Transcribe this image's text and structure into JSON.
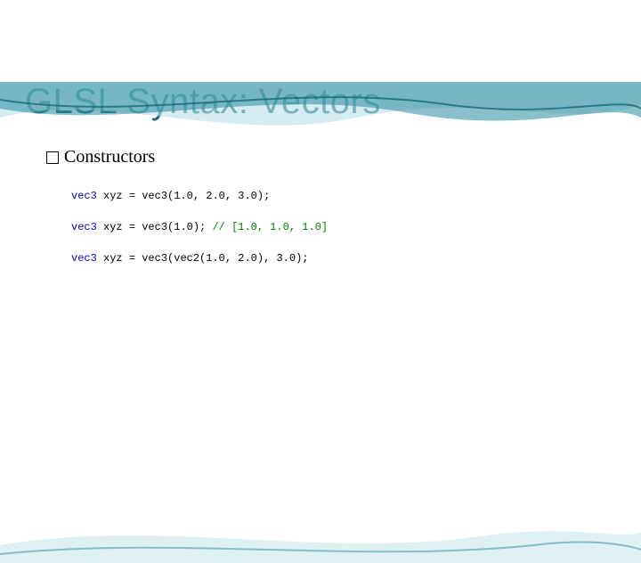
{
  "title": "GLSL Syntax: Vectors",
  "subtitle": "Constructors",
  "code": {
    "lines": [
      {
        "kw": "vec3",
        "var": " xyz ",
        "op": "= ",
        "fn": "vec3",
        "args": "(1.0, 2.0, 3.0);",
        "cmt": ""
      },
      {
        "kw": "vec3",
        "var": " xyz ",
        "op": "= ",
        "fn": "vec3",
        "args": "(1.0); ",
        "cmt": "// [1.0, 1.0, 1.0]"
      },
      {
        "kw": "vec3",
        "var": " xyz ",
        "op": "= ",
        "fn": "vec3",
        "args": "(vec2(1.0, 2.0), 3.0);",
        "cmt": ""
      }
    ]
  },
  "colors": {
    "title": "#1f6b7a",
    "keyword": "#0000cc",
    "comment": "#008000"
  }
}
